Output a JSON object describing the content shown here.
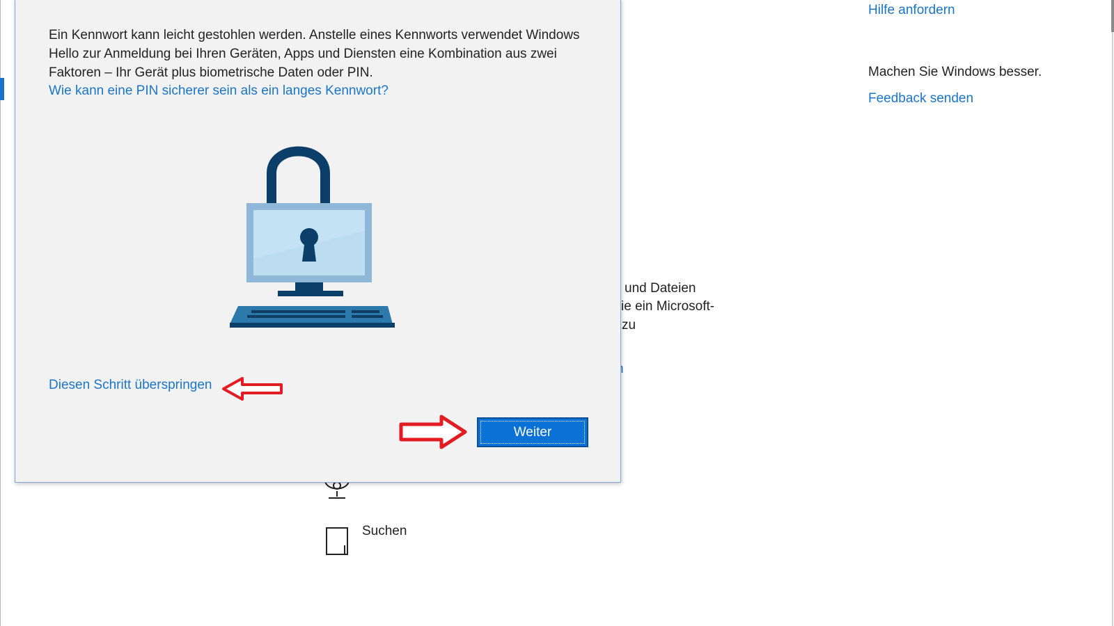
{
  "background": {
    "help_link": "Hilfe anfordern",
    "improve_text": "Machen Sie Windows besser.",
    "feedback_link": "Feedback senden",
    "fragments": [
      "und Dateien",
      "ie ein Microsoft-",
      "zu",
      "n"
    ],
    "search_label": "Suchen"
  },
  "dialog": {
    "body_text": "Ein Kennwort kann leicht gestohlen werden. Anstelle eines Kennworts verwendet Windows Hello zur Anmeldung bei Ihren Geräten, Apps und Diensten eine Kombination aus zwei Faktoren – Ihr Gerät plus biometrische Daten oder PIN.",
    "info_link": "Wie kann eine PIN sicherer sein als ein langes Kennwort?",
    "skip_link": "Diesen Schritt überspringen",
    "next_button": "Weiter"
  },
  "colors": {
    "link": "#1b75c8",
    "button": "#0a72d6",
    "annotation_arrow": "#e31b23"
  },
  "icons": {
    "illustration": "padlock-computer-icon",
    "skip_arrow": "red-arrow-left-icon",
    "next_arrow": "red-arrow-right-icon",
    "webcam": "webcam-icon",
    "search_device": "tablet-icon"
  }
}
